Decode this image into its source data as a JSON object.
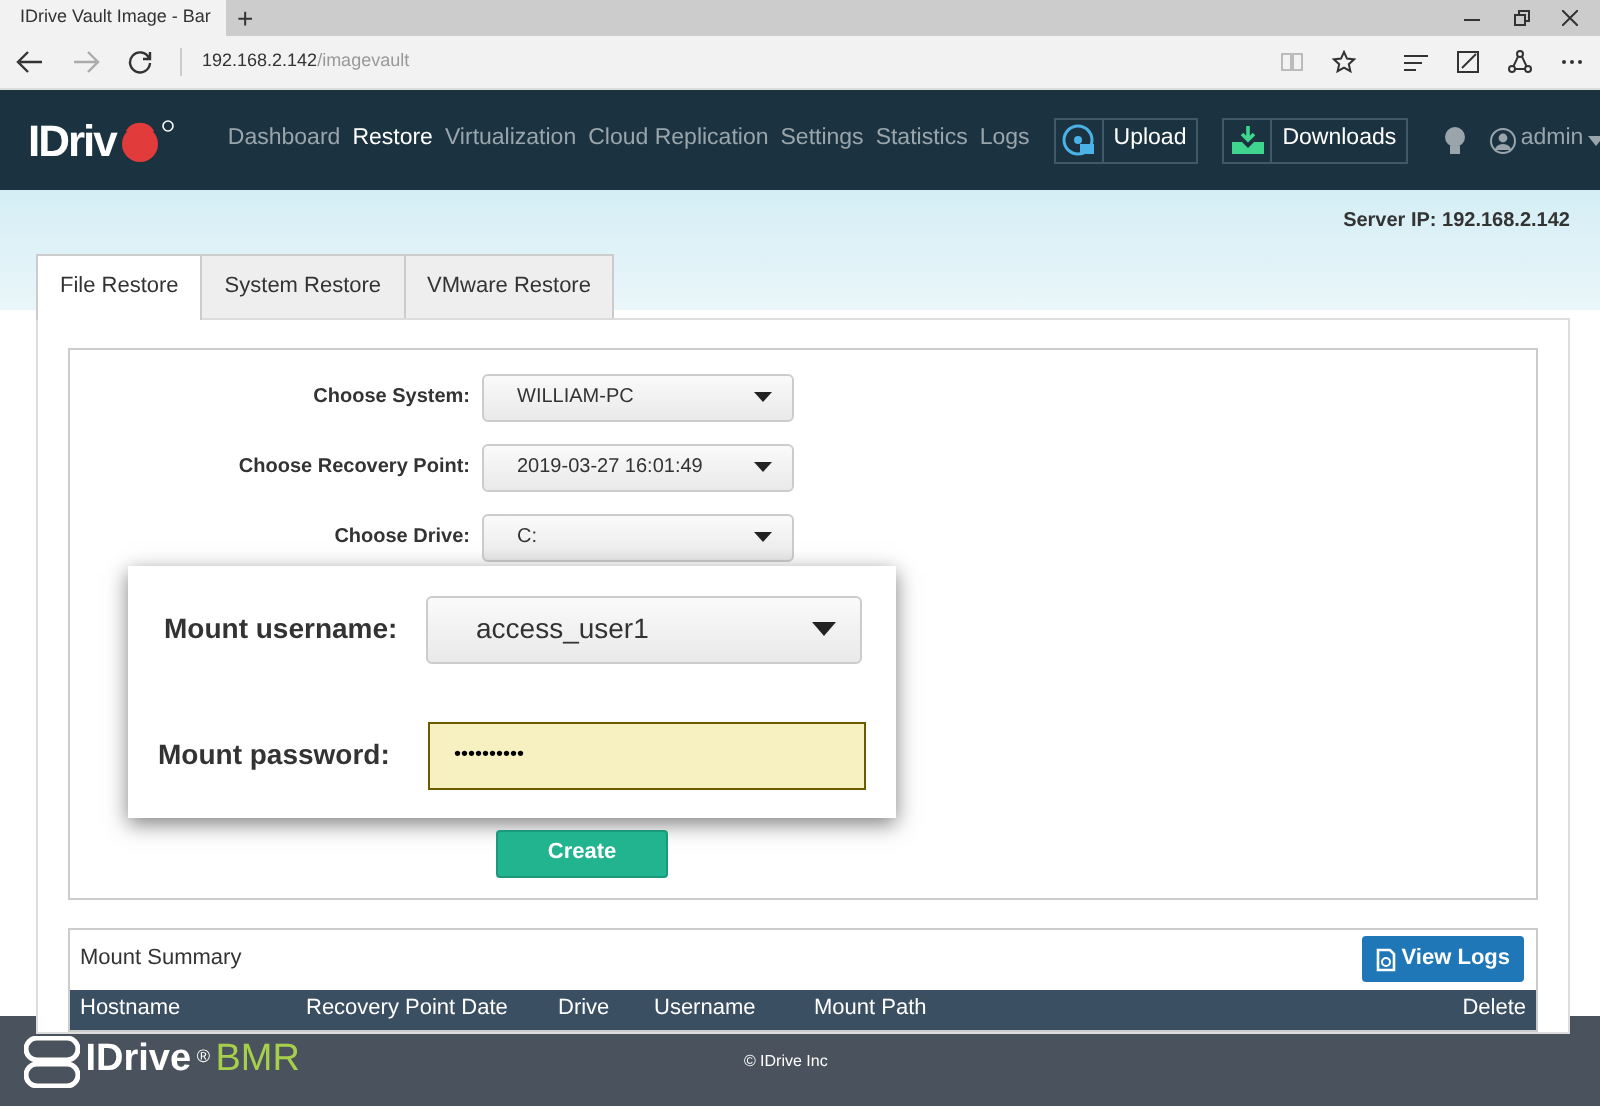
{
  "browser": {
    "tab_title": "IDrive Vault Image - Bar",
    "new_tab": "+",
    "url_host": "192.168.2.142",
    "url_path": "/imagevault"
  },
  "nav": {
    "items": [
      {
        "label": "Dashboard",
        "selected": false
      },
      {
        "label": "Restore",
        "selected": true
      },
      {
        "label": "Virtualization",
        "selected": false
      },
      {
        "label": "Cloud Replication",
        "selected": false
      },
      {
        "label": "Settings",
        "selected": false
      },
      {
        "label": "Statistics",
        "selected": false
      },
      {
        "label": "Logs",
        "selected": false
      }
    ],
    "buttons": [
      {
        "label": "Upload",
        "kind": "upload"
      },
      {
        "label": "Downloads",
        "kind": "download"
      }
    ],
    "user": "admin"
  },
  "logo_text": "IDriv",
  "server_ip": "Server IP: 192.168.2.142",
  "tabs": [
    {
      "label": "File Restore",
      "selected": true
    },
    {
      "label": "System Restore",
      "selected": false
    },
    {
      "label": "VMware Restore",
      "selected": false
    }
  ],
  "form": {
    "fields": [
      {
        "label": "Choose System:",
        "value": "WILLIAM-PC"
      },
      {
        "label": "Choose Recovery Point:",
        "value": "2019-03-27 16:01:49"
      },
      {
        "label": "Choose Drive:",
        "value": "C:"
      }
    ],
    "create": "Create"
  },
  "mount_popup": {
    "username_label": "Mount username:",
    "username": "access_user1",
    "password_label": "Mount password:",
    "password": "••••••••••"
  },
  "mount_summary": {
    "title": "Mount Summary",
    "view_logs": "View Logs",
    "columns": [
      "Hostname",
      "Recovery Point Date",
      "Drive",
      "Username",
      "Mount Path",
      "Delete"
    ]
  },
  "footer": {
    "brand": "IDrive",
    "reg": "®",
    "product": "BMR",
    "copyright": "© IDrive Inc"
  }
}
